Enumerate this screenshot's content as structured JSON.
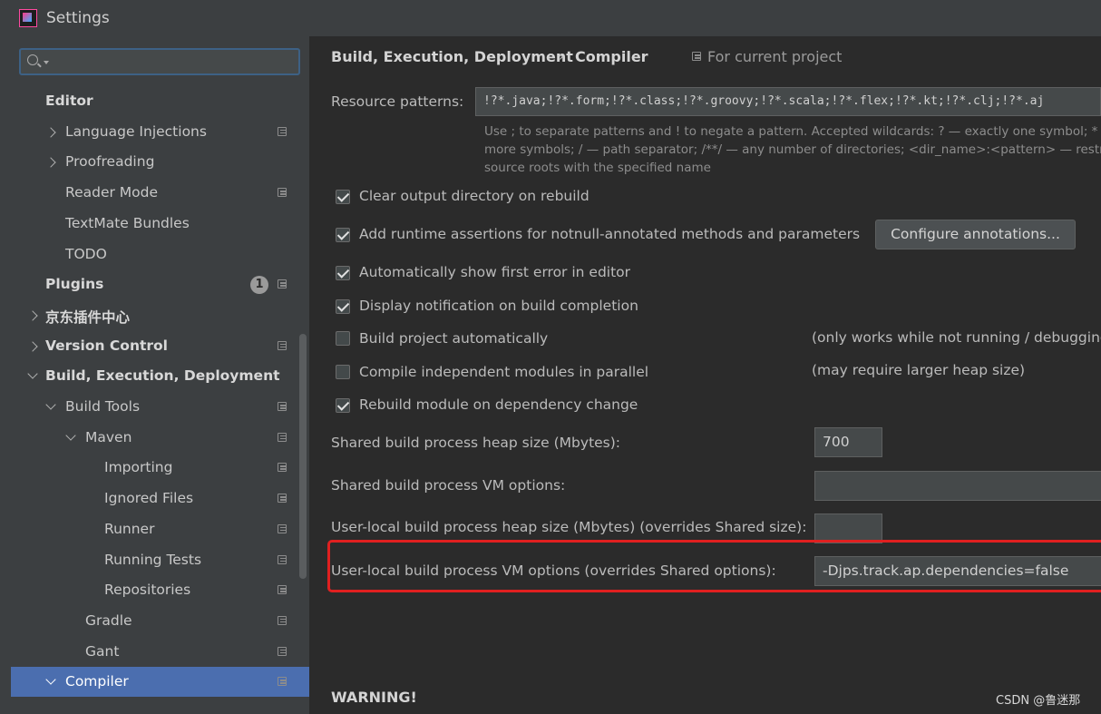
{
  "window": {
    "title": "Settings"
  },
  "search": {
    "placeholder": ""
  },
  "sidebar": {
    "items": [
      {
        "label": "Editor",
        "bold": true,
        "indent": 0,
        "chevron": "none",
        "scope": false
      },
      {
        "label": "Language Injections",
        "bold": false,
        "indent": 1,
        "chevron": "right",
        "scope": true
      },
      {
        "label": "Proofreading",
        "bold": false,
        "indent": 1,
        "chevron": "right",
        "scope": false
      },
      {
        "label": "Reader Mode",
        "bold": false,
        "indent": 1,
        "chevron": "none",
        "scope": true
      },
      {
        "label": "TextMate Bundles",
        "bold": false,
        "indent": 1,
        "chevron": "none",
        "scope": false
      },
      {
        "label": "TODO",
        "bold": false,
        "indent": 1,
        "chevron": "none",
        "scope": false
      },
      {
        "label": "Plugins",
        "bold": true,
        "indent": 0,
        "chevron": "none",
        "scope": true,
        "badge": "1"
      },
      {
        "label": "京东插件中心",
        "bold": true,
        "indent": 0,
        "chevron": "right",
        "scope": false
      },
      {
        "label": "Version Control",
        "bold": true,
        "indent": 0,
        "chevron": "right",
        "scope": true
      },
      {
        "label": "Build, Execution, Deployment",
        "bold": true,
        "indent": 0,
        "chevron": "down",
        "scope": false
      },
      {
        "label": "Build Tools",
        "bold": false,
        "indent": 1,
        "chevron": "down",
        "scope": true
      },
      {
        "label": "Maven",
        "bold": false,
        "indent": 2,
        "chevron": "down",
        "scope": true
      },
      {
        "label": "Importing",
        "bold": false,
        "indent": 3,
        "chevron": "none",
        "scope": true
      },
      {
        "label": "Ignored Files",
        "bold": false,
        "indent": 3,
        "chevron": "none",
        "scope": true
      },
      {
        "label": "Runner",
        "bold": false,
        "indent": 3,
        "chevron": "none",
        "scope": true
      },
      {
        "label": "Running Tests",
        "bold": false,
        "indent": 3,
        "chevron": "none",
        "scope": true
      },
      {
        "label": "Repositories",
        "bold": false,
        "indent": 3,
        "chevron": "none",
        "scope": true
      },
      {
        "label": "Gradle",
        "bold": false,
        "indent": 2,
        "chevron": "none",
        "scope": true
      },
      {
        "label": "Gant",
        "bold": false,
        "indent": 2,
        "chevron": "none",
        "scope": true
      },
      {
        "label": "Compiler",
        "bold": false,
        "indent": 1,
        "chevron": "down",
        "scope": true,
        "selected": true
      }
    ]
  },
  "main": {
    "breadcrumb": {
      "parent": "Build, Execution, Deployment",
      "separator": "›",
      "current": "Compiler",
      "scope_label": "For current project"
    },
    "resource_patterns": {
      "label": "Resource patterns:",
      "value": "!?*.java;!?*.form;!?*.class;!?*.groovy;!?*.scala;!?*.flex;!?*.kt;!?*.clj;!?*.aj",
      "hint_line1": "Use ; to separate patterns and ! to negate a pattern. Accepted wildcards: ? — exactly one symbol; * — zero or",
      "hint_line2": "more symbols; / — path separator; /**/ — any number of directories; <dir_name>:<pattern> — restrict to",
      "hint_line3": "source roots with the specified name"
    },
    "checkboxes": {
      "clear_output": {
        "label": "Clear output directory on rebuild",
        "checked": true
      },
      "runtime_assertions": {
        "label": "Add runtime assertions for notnull-annotated methods and parameters",
        "checked": true
      },
      "show_first_error": {
        "label": "Automatically show first error in editor",
        "checked": true
      },
      "display_notification": {
        "label": "Display notification on build completion",
        "checked": true
      },
      "build_auto": {
        "label": "Build project automatically",
        "checked": false,
        "note": "(only works while not running / debugging)"
      },
      "compile_parallel": {
        "label": "Compile independent modules in parallel",
        "checked": false,
        "note": "(may require larger heap size)"
      },
      "rebuild_module": {
        "label": "Rebuild module on dependency change",
        "checked": true
      }
    },
    "configure_annotations_label": "Configure annotations...",
    "shared_heap": {
      "label": "Shared build process heap size (Mbytes):",
      "value": "700"
    },
    "shared_vm": {
      "label": "Shared build process VM options:",
      "value": ""
    },
    "user_heap": {
      "label": "User-local build process heap size (Mbytes) (overrides Shared size):",
      "value": ""
    },
    "user_vm": {
      "label": "User-local build process VM options (overrides Shared options):",
      "value": "-Djps.track.ap.dependencies=false"
    },
    "warning_title": "WARNING!"
  },
  "watermark": "CSDN @鲁迷那",
  "colors": {
    "selection": "#4b6eaf",
    "highlight_border": "#e02020",
    "background": "#2b2b2b",
    "sidebar": "#3c3f41"
  }
}
